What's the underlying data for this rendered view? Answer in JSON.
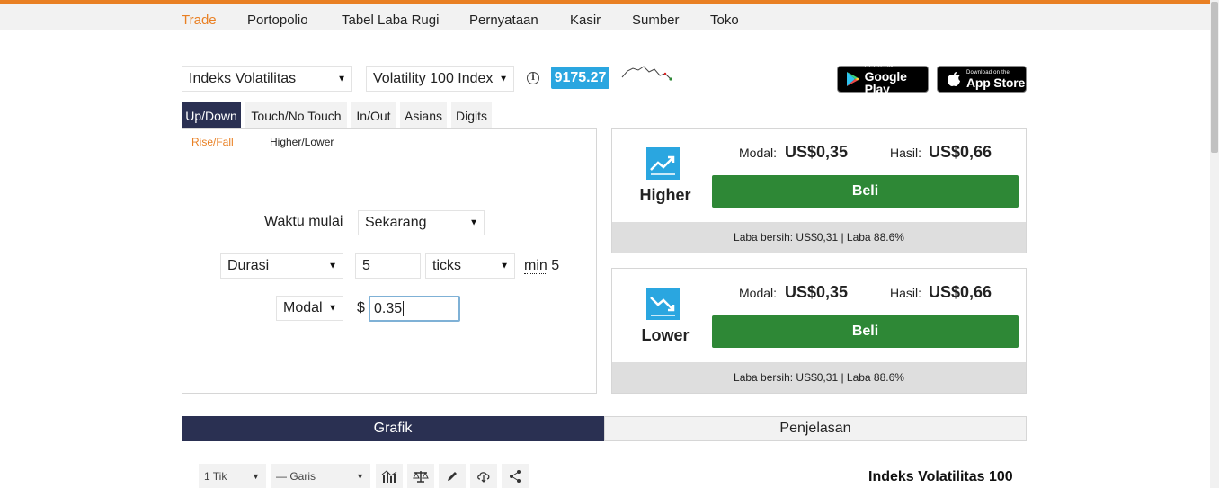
{
  "nav": {
    "items": [
      {
        "label": "Trade",
        "active": true
      },
      {
        "label": "Portopolio"
      },
      {
        "label": "Tabel Laba Rugi"
      },
      {
        "label": "Pernyataan"
      },
      {
        "label": "Kasir"
      },
      {
        "label": "Sumber"
      },
      {
        "label": "Toko"
      }
    ]
  },
  "market": {
    "category": "Indeks Volatilitas",
    "underlying": "Volatility 100 Index",
    "spot_price": "9175.27"
  },
  "stores": {
    "google": {
      "small": "GET IT ON",
      "big": "Google Play"
    },
    "apple": {
      "small": "Download on the",
      "big": "App Store"
    }
  },
  "contract_tabs": [
    "Up/Down",
    "Touch/No Touch",
    "In/Out",
    "Asians",
    "Digits"
  ],
  "sub_tabs": [
    "Rise/Fall",
    "Higher/Lower"
  ],
  "form": {
    "start_label": "Waktu mulai",
    "start_value": "Sekarang",
    "duration_type": "Durasi",
    "duration_value": "5",
    "duration_unit": "ticks",
    "min_prefix": "min",
    "min_value": "5",
    "amount_type": "Modal",
    "currency_symbol": "$",
    "amount_value": "0.35"
  },
  "cards": [
    {
      "title": "Higher",
      "stake_label": "Modal:",
      "stake_value": "US$0,35",
      "payout_label": "Hasil:",
      "payout_value": "US$0,66",
      "buy_label": "Beli",
      "footer": "Laba bersih: US$0,31 | Laba 88.6%",
      "icon": "trend-up-icon"
    },
    {
      "title": "Lower",
      "stake_label": "Modal:",
      "stake_value": "US$0,35",
      "payout_label": "Hasil:",
      "payout_value": "US$0,66",
      "buy_label": "Beli",
      "footer": "Laba bersih: US$0,31 | Laba 88.6%",
      "icon": "trend-down-icon"
    }
  ],
  "bottom_tabs": [
    "Grafik",
    "Penjelasan"
  ],
  "chart_toolbar": {
    "interval": "1 Tik",
    "chart_type": "— Garis",
    "title": "Indeks Volatilitas 100"
  },
  "colors": {
    "accent": "#e98024",
    "dark_tab": "#2a3052",
    "buy": "#2e8836",
    "badge": "#2aa6e0"
  }
}
